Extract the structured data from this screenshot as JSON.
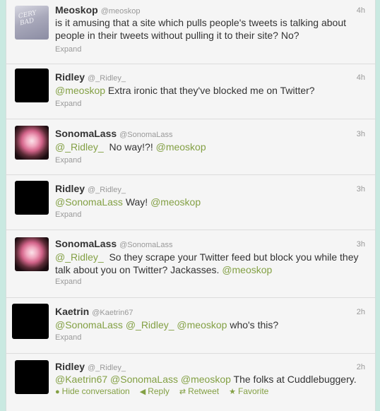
{
  "tweets": [
    {
      "name": "Meoskop",
      "handle": "@meoskop",
      "time": "4h",
      "avatar": "photo-meo",
      "avatar_text": "CERY\nBAD",
      "segments": [
        {
          "t": "is it amusing that a site which pulls people's tweets is talking about people in their tweets without pulling it to their site? No?",
          "m": false
        }
      ],
      "expand": "Expand"
    },
    {
      "name": "Ridley",
      "handle": "@_Ridley_",
      "time": "4h",
      "avatar": "black",
      "segments": [
        {
          "t": "@meoskop",
          "m": true
        },
        {
          "t": " Extra ironic that they've blocked me on Twitter?",
          "m": false
        }
      ],
      "expand": "Expand"
    },
    {
      "name": "SonomaLass",
      "handle": "@SonomaLass",
      "time": "3h",
      "avatar": "photo-rose",
      "segments": [
        {
          "t": "@_Ridley_",
          "m": true
        },
        {
          "t": "  No way!?! ",
          "m": false
        },
        {
          "t": "@meoskop",
          "m": true
        }
      ],
      "expand": "Expand"
    },
    {
      "name": "Ridley",
      "handle": "@_Ridley_",
      "time": "3h",
      "avatar": "black",
      "segments": [
        {
          "t": "@SonomaLass",
          "m": true
        },
        {
          "t": " Way! ",
          "m": false
        },
        {
          "t": "@meoskop",
          "m": true
        }
      ],
      "expand": "Expand"
    },
    {
      "name": "SonomaLass",
      "handle": "@SonomaLass",
      "time": "3h",
      "avatar": "photo-rose",
      "segments": [
        {
          "t": "@_Ridley_",
          "m": true
        },
        {
          "t": "  So they scrape your Twitter feed but block you while they talk about you on Twitter? Jackasses. ",
          "m": false
        },
        {
          "t": "@meoskop",
          "m": true
        }
      ],
      "expand": "Expand"
    },
    {
      "name": "Kaetrin",
      "handle": "@Kaetrin67",
      "time": "2h",
      "avatar": "black",
      "segments": [
        {
          "t": "@SonomaLass",
          "m": true
        },
        {
          "t": " ",
          "m": false
        },
        {
          "t": "@_Ridley_",
          "m": true
        },
        {
          "t": " ",
          "m": false
        },
        {
          "t": "@meoskop",
          "m": true
        },
        {
          "t": " who's this?",
          "m": false
        }
      ],
      "expand": "Expand"
    },
    {
      "name": "Ridley",
      "handle": "@_Ridley_",
      "time": "2h",
      "avatar": "black",
      "segments": [
        {
          "t": "@Kaetrin67",
          "m": true
        },
        {
          "t": " ",
          "m": false
        },
        {
          "t": "@SonomaLass",
          "m": true
        },
        {
          "t": " ",
          "m": false
        },
        {
          "t": "@meoskop",
          "m": true
        },
        {
          "t": " The folks at Cuddlebuggery.",
          "m": false
        }
      ],
      "actions": [
        {
          "icon": "speech-bubble-icon",
          "glyph": "●",
          "label": "Hide conversation"
        },
        {
          "icon": "reply-icon",
          "glyph": "◀",
          "label": "Reply"
        },
        {
          "icon": "retweet-icon",
          "glyph": "⇄",
          "label": "Retweet"
        },
        {
          "icon": "star-icon",
          "glyph": "★",
          "label": "Favorite"
        }
      ]
    }
  ],
  "colors": {
    "mention": "#83a044",
    "text": "#333333",
    "meta": "#999999",
    "background": "#c9e9e1"
  }
}
